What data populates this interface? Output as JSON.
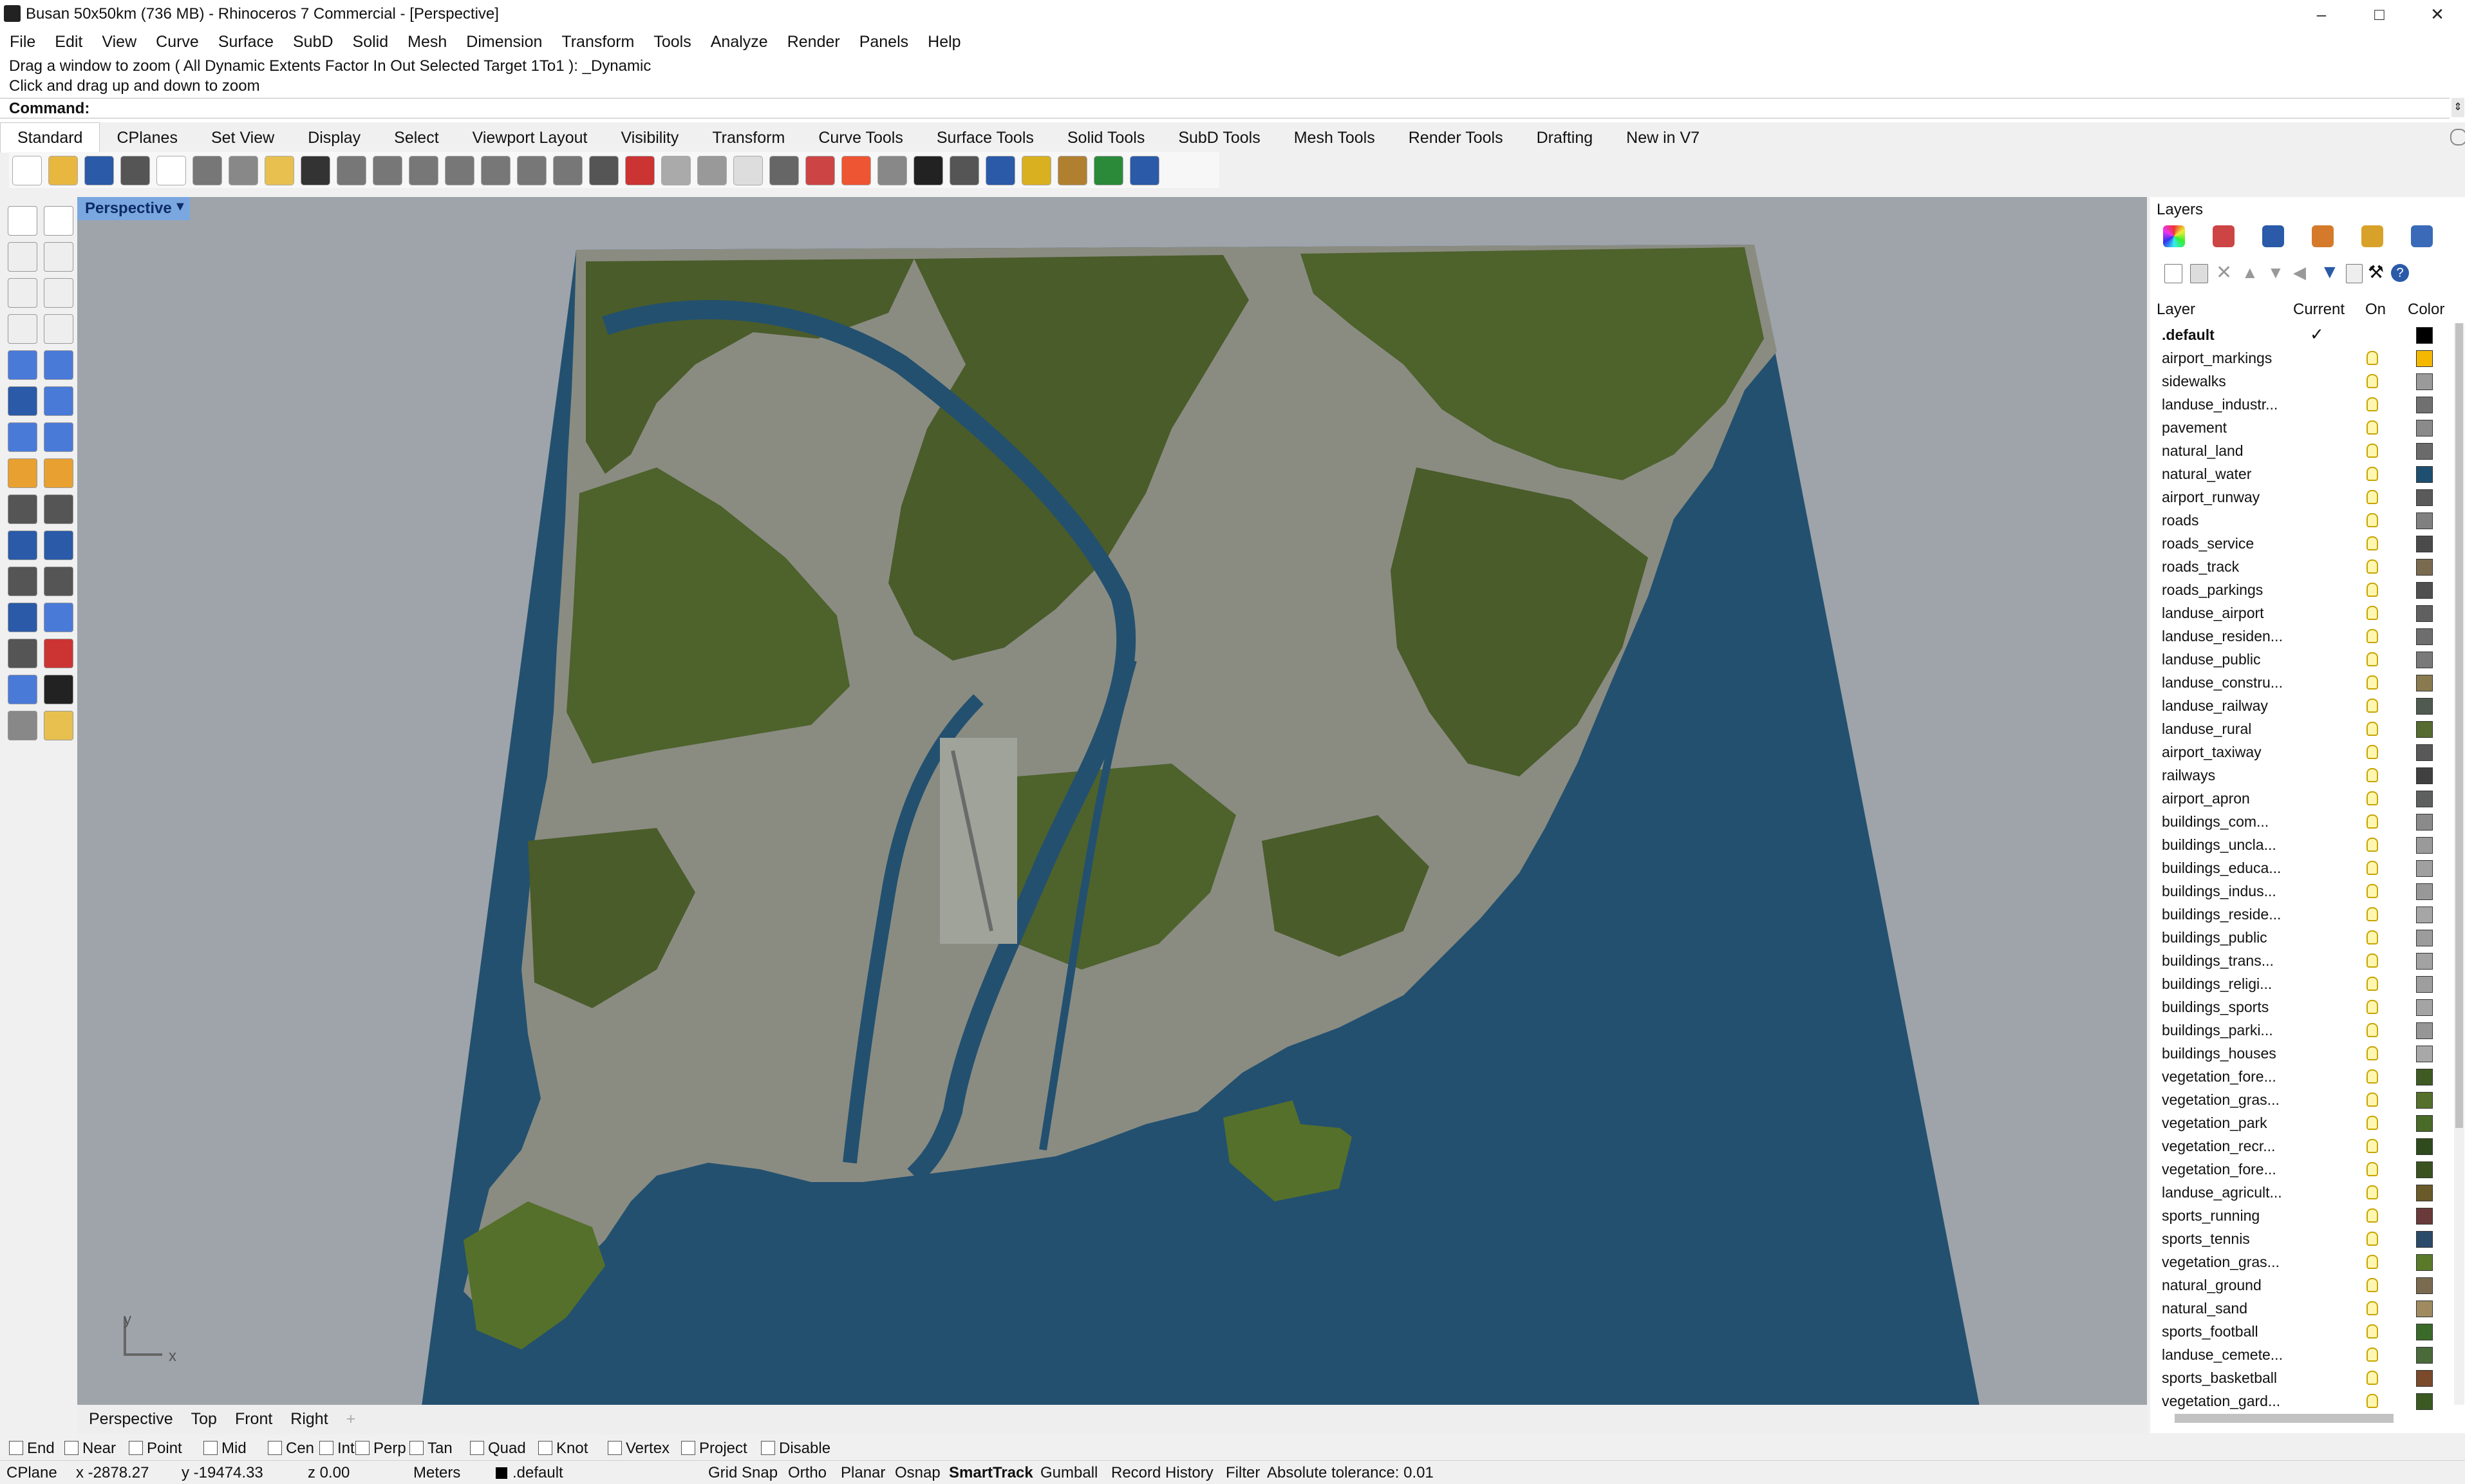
{
  "window": {
    "title": "Busan 50x50km (736 MB) - Rhinoceros 7 Commercial - [Perspective]",
    "minimize": "–",
    "maximize": "□",
    "close": "✕"
  },
  "menu": [
    "File",
    "Edit",
    "View",
    "Curve",
    "Surface",
    "SubD",
    "Solid",
    "Mesh",
    "Dimension",
    "Transform",
    "Tools",
    "Analyze",
    "Render",
    "Panels",
    "Help"
  ],
  "command": {
    "history_line1": "Drag a window to zoom ( All  Dynamic  Extents  Factor  In  Out  Selected  Target  1To1 ): _Dynamic",
    "history_line2": "Click and drag up and down to zoom",
    "prompt": "Command:"
  },
  "toolbar_tabs": [
    "Standard",
    "CPlanes",
    "Set View",
    "Display",
    "Select",
    "Viewport Layout",
    "Visibility",
    "Transform",
    "Curve Tools",
    "Surface Tools",
    "Solid Tools",
    "SubD Tools",
    "Mesh Tools",
    "Render Tools",
    "Drafting",
    "New in V7"
  ],
  "toolbar_icons": [
    "new-icon",
    "open-icon",
    "save-icon",
    "print-icon",
    "import-icon",
    "cut-icon",
    "copy-icon",
    "paste-icon",
    "undo-icon",
    "pan-icon",
    "rotate-icon",
    "zoom-icon",
    "zoom-window-icon",
    "zoom-extents-icon",
    "zoom-selected-icon",
    "rotate-view-icon",
    "four-view-icon",
    "car-icon",
    "cplane-icon",
    "grid-icon",
    "light-icon",
    "lock-icon",
    "layer-icon",
    "color-wheel-icon",
    "material-icon",
    "render-sphere-icon",
    "shade-icon",
    "lights-icon",
    "settings-gear-icon",
    "options-icon",
    "globe-icon",
    "help-icon"
  ],
  "viewport": {
    "name": "Perspective",
    "axis_x": "x",
    "axis_y": "y",
    "water_color": "#23506f",
    "forest_color": "#4a5c2a",
    "urban_color": "#8a8c82",
    "background_color": "#9ea4aa"
  },
  "viewport_tabs": [
    "Perspective",
    "Top",
    "Front",
    "Right"
  ],
  "layers": {
    "title": "Layers",
    "columns": {
      "layer": "Layer",
      "current": "Current",
      "on": "On",
      "color": "Color"
    },
    "current_mark": "✓",
    "rows": [
      {
        "name": ".default",
        "color": "#000000"
      },
      {
        "name": "airport_markings",
        "color": "#f5b800"
      },
      {
        "name": "sidewalks",
        "color": "#9a9a9a"
      },
      {
        "name": "landuse_industr...",
        "color": "#707070"
      },
      {
        "name": "pavement",
        "color": "#8a8a8a"
      },
      {
        "name": "natural_land",
        "color": "#6b6b6b"
      },
      {
        "name": "natural_water",
        "color": "#1f4f70"
      },
      {
        "name": "airport_runway",
        "color": "#5a5a5a"
      },
      {
        "name": "roads",
        "color": "#808080"
      },
      {
        "name": "roads_service",
        "color": "#4a4a4a"
      },
      {
        "name": "roads_track",
        "color": "#7a6a50"
      },
      {
        "name": "roads_parkings",
        "color": "#505050"
      },
      {
        "name": "landuse_airport",
        "color": "#606060"
      },
      {
        "name": "landuse_residen...",
        "color": "#6e6e6e"
      },
      {
        "name": "landuse_public",
        "color": "#7a7a7a"
      },
      {
        "name": "landuse_constru...",
        "color": "#8a7a50"
      },
      {
        "name": "landuse_railway",
        "color": "#505a50"
      },
      {
        "name": "landuse_rural",
        "color": "#556b30"
      },
      {
        "name": "airport_taxiway",
        "color": "#585858"
      },
      {
        "name": "railways",
        "color": "#404040"
      },
      {
        "name": "airport_apron",
        "color": "#5e6060"
      },
      {
        "name": "buildings_com...",
        "color": "#8a8a8a"
      },
      {
        "name": "buildings_uncla...",
        "color": "#9a9a9a"
      },
      {
        "name": "buildings_educa...",
        "color": "#a0a0a0"
      },
      {
        "name": "buildings_indus...",
        "color": "#989898"
      },
      {
        "name": "buildings_reside...",
        "color": "#a6a6a6"
      },
      {
        "name": "buildings_public",
        "color": "#9c9c9c"
      },
      {
        "name": "buildings_trans...",
        "color": "#a2a2a2"
      },
      {
        "name": "buildings_religi...",
        "color": "#9e9e9e"
      },
      {
        "name": "buildings_sports",
        "color": "#a4a4a4"
      },
      {
        "name": "buildings_parki...",
        "color": "#969696"
      },
      {
        "name": "buildings_houses",
        "color": "#a8a8a8"
      },
      {
        "name": "vegetation_fore...",
        "color": "#3f5a22"
      },
      {
        "name": "vegetation_gras...",
        "color": "#55702a"
      },
      {
        "name": "vegetation_park",
        "color": "#4a6a28"
      },
      {
        "name": "vegetation_recr...",
        "color": "#2f4a1c"
      },
      {
        "name": "vegetation_fore...",
        "color": "#3a5220"
      },
      {
        "name": "landuse_agricult...",
        "color": "#6a5a2a"
      },
      {
        "name": "sports_running",
        "color": "#6a3a3a"
      },
      {
        "name": "sports_tennis",
        "color": "#2a4a6a"
      },
      {
        "name": "vegetation_gras...",
        "color": "#5a7a2a"
      },
      {
        "name": "natural_ground",
        "color": "#7a6a50"
      },
      {
        "name": "natural_sand",
        "color": "#a08a60"
      },
      {
        "name": "sports_football",
        "color": "#3a6a2a"
      },
      {
        "name": "landuse_cemete...",
        "color": "#4a6a3a"
      },
      {
        "name": "sports_basketball",
        "color": "#7a4a2a"
      },
      {
        "name": "vegetation_gard...",
        "color": "#3a5a22"
      }
    ]
  },
  "osnaps": [
    {
      "label": "End",
      "checked": false
    },
    {
      "label": "Near",
      "checked": false
    },
    {
      "label": "Point",
      "checked": false
    },
    {
      "label": "Mid",
      "checked": false
    },
    {
      "label": "Cen",
      "checked": false
    },
    {
      "label": "Int",
      "checked": false
    },
    {
      "label": "Perp",
      "checked": false
    },
    {
      "label": "Tan",
      "checked": false
    },
    {
      "label": "Quad",
      "checked": false
    },
    {
      "label": "Knot",
      "checked": false
    },
    {
      "label": "Vertex",
      "checked": false
    },
    {
      "label": "Project",
      "checked": false
    },
    {
      "label": "Disable",
      "checked": false
    }
  ],
  "status": {
    "cplane": "CPlane",
    "x": "x -2878.27",
    "y": "y -19474.33",
    "z": "z 0.00",
    "units": "Meters",
    "layer": ".default",
    "grid_snap": "Grid Snap",
    "ortho": "Ortho",
    "planar": "Planar",
    "osnap": "Osnap",
    "smarttrack": "SmartTrack",
    "gumball": "Gumball",
    "record_history": "Record History",
    "filter": "Filter",
    "tolerance": "Absolute tolerance: 0.01"
  }
}
